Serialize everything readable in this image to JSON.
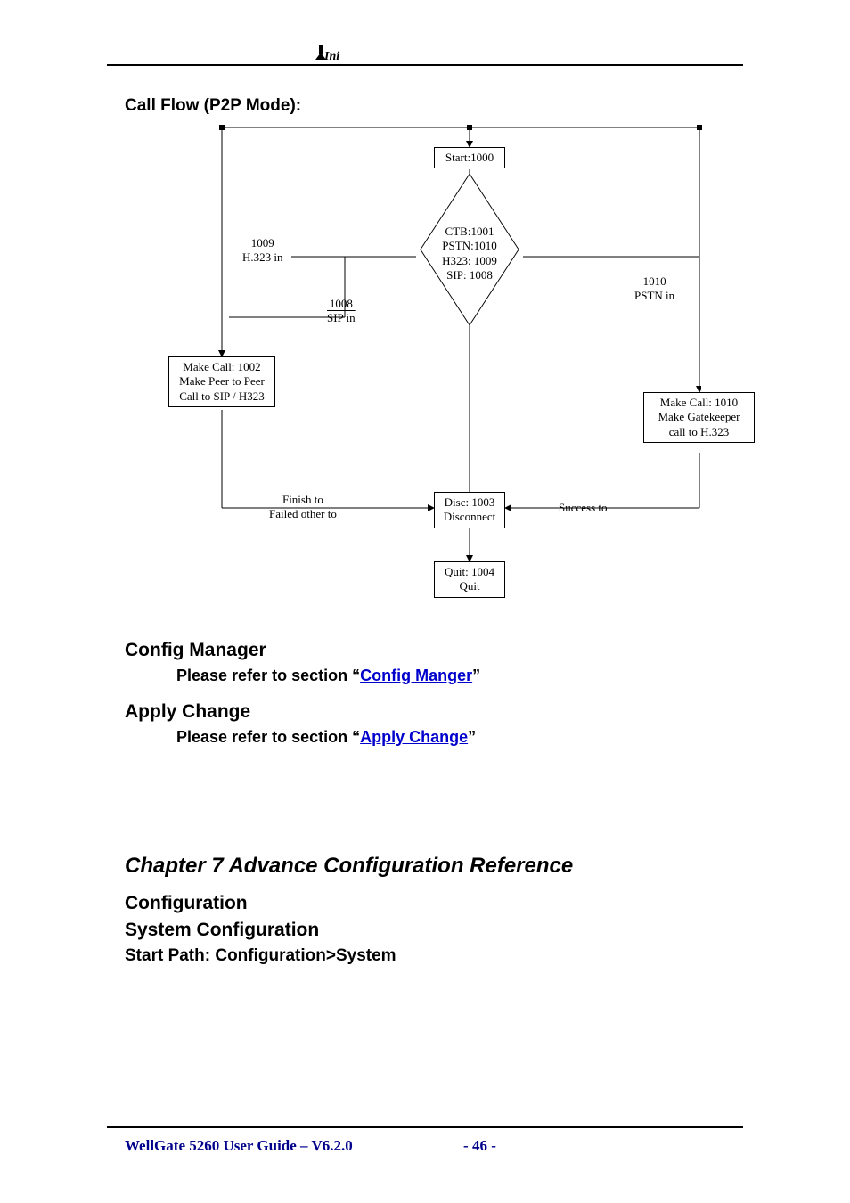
{
  "logo_text": "Ini",
  "sections": {
    "call_flow_heading": "Call Flow (P2P Mode):",
    "config_manager_heading": "Config Manager",
    "config_manager_ref_prefix": "Please refer to section “",
    "config_manager_link": "Config Manger",
    "config_manager_ref_suffix": "”",
    "apply_change_heading": "Apply Change",
    "apply_change_ref_prefix": "Please refer to section “",
    "apply_change_link": "Apply Change",
    "apply_change_ref_suffix": "”",
    "chapter_heading": "Chapter 7 Advance Configuration Reference",
    "configuration_heading": "Configuration",
    "system_config_heading": "System Configuration",
    "start_path": "Start Path: Configuration>System"
  },
  "diagram": {
    "start": "Start:1000",
    "decision_l1": "CTB:1001",
    "decision_l2": "PSTN:1010",
    "decision_l3": "H323: 1009",
    "decision_l4": "SIP: 1008",
    "h323_in_num": "1009",
    "h323_in_label": "H.323 in",
    "sip_in_num": "1008",
    "sip_in_label": "SIP in",
    "pstn_in_num": "1010",
    "pstn_in_label": "PSTN in",
    "makecall_left_l1": "Make Call: 1002",
    "makecall_left_l2": "Make Peer to Peer",
    "makecall_left_l3": "Call to SIP / H323",
    "makecall_right_l1": "Make Call: 1010",
    "makecall_right_l2": "Make Gatekeeper",
    "makecall_right_l3": "call to H.323",
    "finish_l1": "Finish to",
    "finish_l2": "Failed other to",
    "disc_l1": "Disc: 1003",
    "disc_l2": "Disconnect",
    "success": "Success to",
    "quit_l1": "Quit: 1004",
    "quit_l2": "Quit"
  },
  "footer": {
    "guide": "WellGate 5260 User Guide – V6.2.0",
    "page": "- 46 -"
  }
}
